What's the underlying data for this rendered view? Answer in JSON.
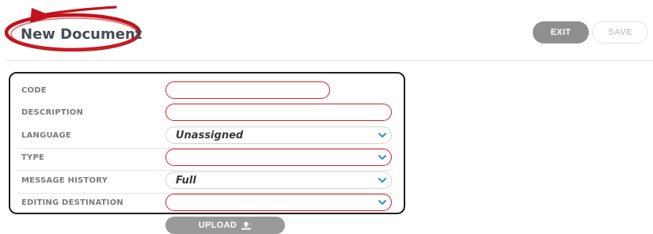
{
  "header": {
    "title": "New Document",
    "exit_label": "EXIT",
    "save_label": "SAVE"
  },
  "form": {
    "fields": [
      {
        "label": "CODE",
        "value": "",
        "control": "text"
      },
      {
        "label": "DESCRIPTION",
        "value": "",
        "control": "text"
      },
      {
        "label": "LANGUAGE",
        "value": "Unassigned",
        "control": "select"
      },
      {
        "label": "TYPE",
        "value": "",
        "control": "select"
      },
      {
        "label": "MESSAGE HISTORY",
        "value": "Full",
        "control": "select"
      },
      {
        "label": "EDITING DESTINATION",
        "value": "",
        "control": "select"
      }
    ],
    "upload_label": "UPLOAD"
  },
  "icons": {
    "select_arrow": "chevron-down-icon",
    "upload": "upload-icon"
  },
  "colors": {
    "required_border": "#d8212a",
    "annotation": "#c0141c",
    "chevron": "#2f8fd8",
    "button_gray": "#8f8f8f"
  }
}
